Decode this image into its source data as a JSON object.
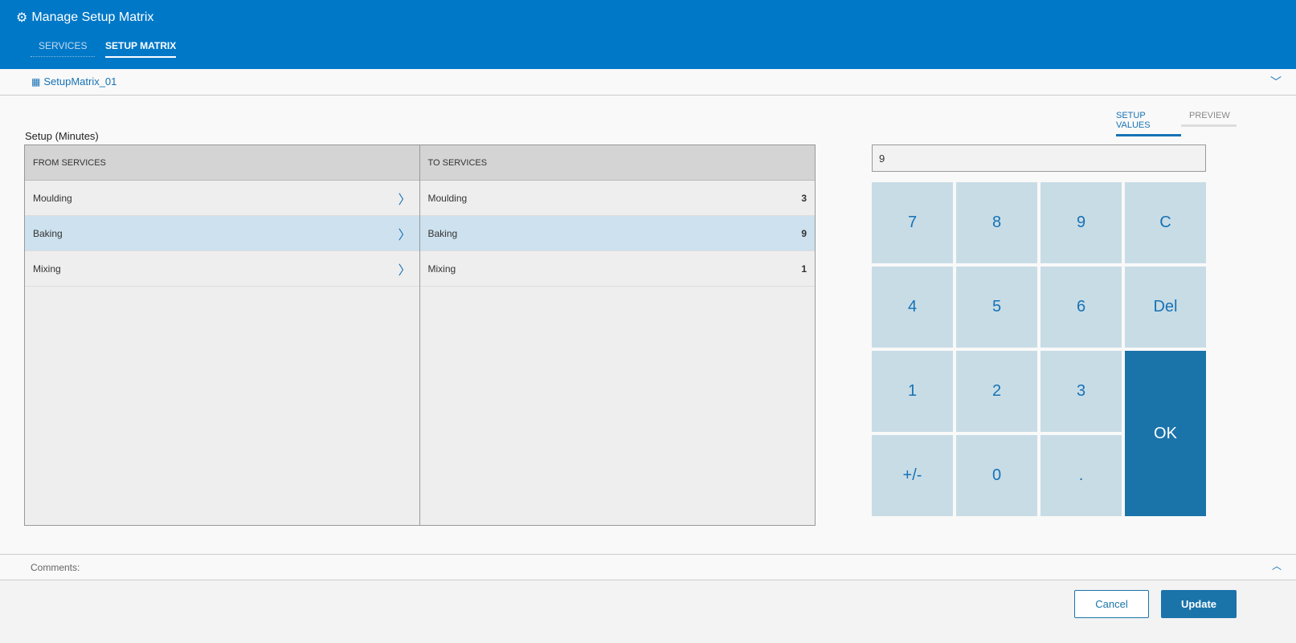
{
  "header": {
    "title": "Manage Setup Matrix",
    "tabs": [
      "SERVICES",
      "SETUP MATRIX"
    ]
  },
  "matrix": {
    "name": "SetupMatrix_01"
  },
  "view_tabs": [
    "SETUP VALUES",
    "PREVIEW"
  ],
  "grid": {
    "label": "Setup (Minutes)",
    "from_header": "FROM SERVICES",
    "to_header": "TO SERVICES",
    "from": [
      "Moulding",
      "Baking",
      "Mixing"
    ],
    "to": [
      {
        "name": "Moulding",
        "value": "3"
      },
      {
        "name": "Baking",
        "value": "9"
      },
      {
        "name": "Mixing",
        "value": "1"
      }
    ]
  },
  "keypad": {
    "display": "9",
    "keys": [
      "7",
      "8",
      "9",
      "C",
      "4",
      "5",
      "6",
      "Del",
      "1",
      "2",
      "3",
      "+/-",
      "0",
      "."
    ],
    "ok": "OK"
  },
  "comments": {
    "label": "Comments:"
  },
  "footer": {
    "cancel": "Cancel",
    "update": "Update"
  }
}
